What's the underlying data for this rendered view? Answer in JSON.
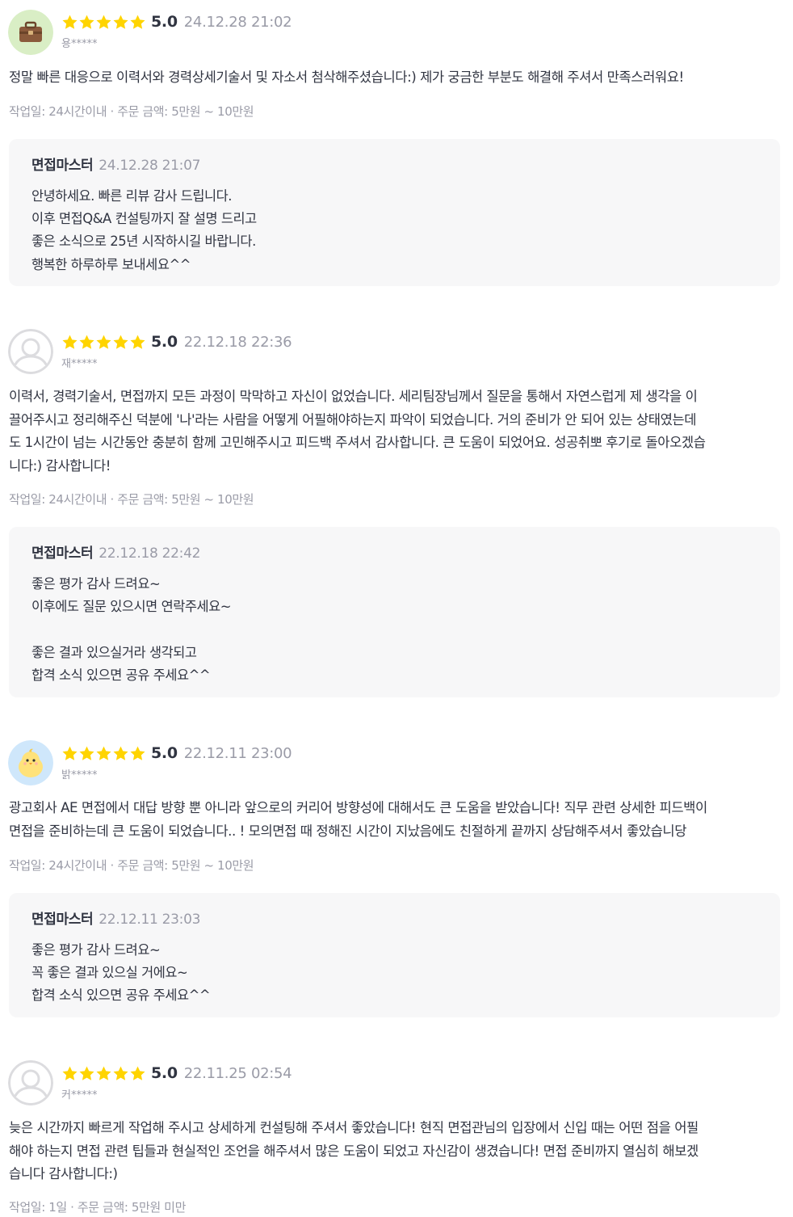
{
  "reviews": [
    {
      "avatar": "briefcase-avatar",
      "score": "5.0",
      "date": "24.12.28 21:02",
      "user": "용*****",
      "text": "정말 빠른 대응으로 이력서와 경력상세기술서 및 자소서 첨삭해주셨습니다:) 제가 궁금한 부분도 해결해 주셔서 만족스러워요!",
      "meta": "작업일: 24시간이내 · 주문 금액: 5만원 ~ 10만원",
      "reply": {
        "author": "면접마스터",
        "date": "24.12.28 21:07",
        "text": "안녕하세요. 빠른 리뷰 감사 드립니다.\n이후 면접Q&A 컨설팅까지 잘 설명 드리고\n좋은 소식으로 25년 시작하시길 바랍니다.\n행복한 하루하루 보내세요^^"
      }
    },
    {
      "avatar": "default-user-avatar",
      "score": "5.0",
      "date": "22.12.18 22:36",
      "user": "재*****",
      "text": "이력서, 경력기술서, 면접까지 모든 과정이 막막하고 자신이 없었습니다. 세리팀장님께서 질문을 통해서 자연스럽게 제 생각을 이\n끌어주시고 정리해주신 덕분에 '나'라는 사람을 어떻게 어필해야하는지 파악이 되었습니다. 거의 준비가 안 되어 있는 상태였는데\n도 1시간이 넘는 시간동안 충분히 함께 고민해주시고 피드백 주셔서 감사합니다. 큰 도움이 되었어요. 성공취뽀 후기로 돌아오겠습\n니다:) 감사합니다!",
      "meta": "작업일: 24시간이내 · 주문 금액: 5만원 ~ 10만원",
      "reply": {
        "author": "면접마스터",
        "date": "22.12.18 22:42",
        "text": "좋은 평가 감사 드려요~\n이후에도 질문 있으시면 연락주세요~\n\n좋은 결과 있으실거라 생각되고\n합격 소식 있으면 공유 주세요^^"
      }
    },
    {
      "avatar": "chick-avatar",
      "score": "5.0",
      "date": "22.12.11 23:00",
      "user": "밝*****",
      "text": "광고회사 AE 면접에서 대답 방향 뿐 아니라 앞으로의 커리어 방향성에 대해서도 큰 도움을 받았습니다! 직무 관련 상세한 피드백이\n면접을 준비하는데 큰 도움이 되었습니다.. ! 모의면접 때 정해진 시간이 지났음에도 친절하게 끝까지 상담해주셔서 좋았습니당",
      "meta": "작업일: 24시간이내 · 주문 금액: 5만원 ~ 10만원",
      "reply": {
        "author": "면접마스터",
        "date": "22.12.11 23:03",
        "text": "좋은 평가 감사 드려요~\n꼭 좋은 결과 있으실 거에요~\n합격 소식 있으면 공유 주세요^^"
      }
    },
    {
      "avatar": "default-user-avatar",
      "score": "5.0",
      "date": "22.11.25 02:54",
      "user": "커*****",
      "text": "늦은 시간까지 빠르게 작업해 주시고 상세하게 컨설팅해 주셔서 좋았습니다! 현직 면접관님의 입장에서 신입 때는 어떤 점을 어필\n해야 하는지 면접 관련 팁들과 현실적인 조언을 해주셔서 많은 도움이 되었고 자신감이 생겼습니다! 면접 준비까지 열심히 해보겠\n습니다 감사합니다:)",
      "meta": "작업일: 1일 · 주문 금액: 5만원 미만"
    }
  ],
  "colors": {
    "star": "#ffd400",
    "text": "#303441",
    "muted": "#9a9ba7",
    "reply_bg": "#f7f7f8"
  }
}
